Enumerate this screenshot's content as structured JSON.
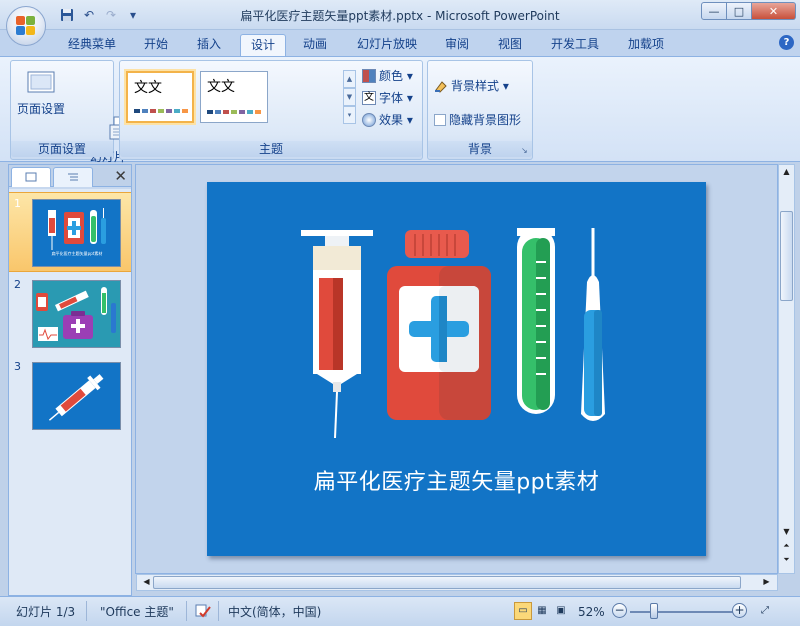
{
  "window": {
    "title": "扁平化医疗主题矢量ppt素材.pptx - Microsoft PowerPoint",
    "minimize": "—",
    "maximize": "□",
    "close": "✕"
  },
  "qat": {
    "save": "💾",
    "undo": "↶",
    "redo": "↷",
    "more": "▾"
  },
  "tabs": [
    {
      "label": "经典菜单"
    },
    {
      "label": "开始"
    },
    {
      "label": "插入"
    },
    {
      "label": "设计",
      "active": true
    },
    {
      "label": "动画"
    },
    {
      "label": "幻灯片放映"
    },
    {
      "label": "审阅"
    },
    {
      "label": "视图"
    },
    {
      "label": "开发工具"
    },
    {
      "label": "加载项"
    }
  ],
  "help": "?",
  "ribbon": {
    "page_setup": {
      "group_label": "页面设置",
      "page_setup_button": "页面设置",
      "orientation_button": "幻灯片\n方向 ▾"
    },
    "themes": {
      "group_label": "主题",
      "thumb1": "文文",
      "thumb2": "文文",
      "colors": "颜色 ▾",
      "fonts": "字体 ▾",
      "effects": "效果 ▾",
      "font_icon": "文"
    },
    "background": {
      "group_label": "背景",
      "styles": "背景样式 ▾",
      "hide_graphics": "隐藏背景图形",
      "hide_checked": false
    }
  },
  "slides_pane": {
    "close": "✕",
    "slides": [
      {
        "number": "1",
        "selected": true
      },
      {
        "number": "2",
        "selected": false
      },
      {
        "number": "3",
        "selected": false
      }
    ],
    "thumb1_caption": "扁平化医疗主题矢量ppt素材"
  },
  "slide": {
    "title": "扁平化医疗主题矢量ppt素材",
    "background": "#1274c6"
  },
  "statusbar": {
    "slide_info": "幻灯片 1/3",
    "theme": "\"Office 主题\"",
    "language": "中文(简体，中国)",
    "zoom": "52%",
    "zoom_out": "−",
    "zoom_in": "+"
  },
  "colors": {
    "accent_red": "#e04a3c",
    "accent_blue": "#1274c6",
    "accent_green": "#35c06a",
    "selection": "#f9c66b"
  }
}
